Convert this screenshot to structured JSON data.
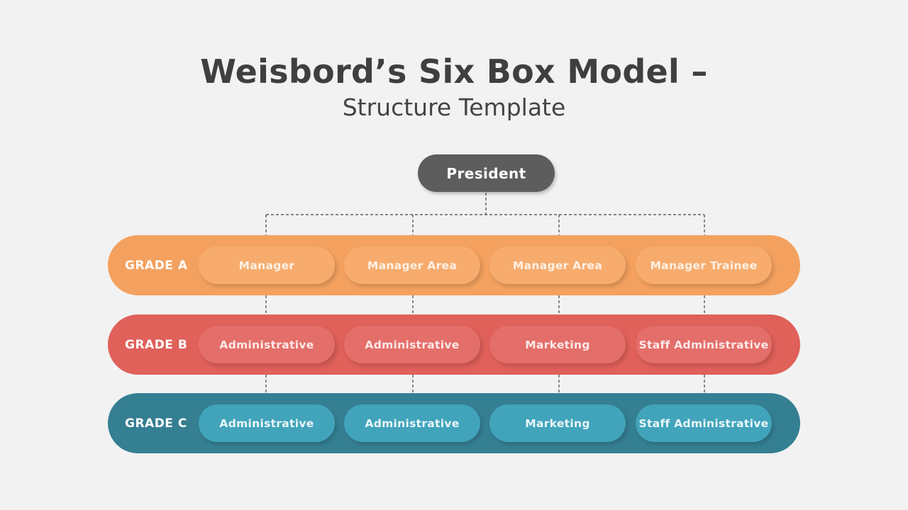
{
  "title": "Weisbord’s Six Box Model –",
  "subtitle": "Structure Template",
  "top_node": {
    "label": "President",
    "color": "#5d5d5d"
  },
  "grades": [
    {
      "label": "GRADE A",
      "color": "#f4a15f",
      "roles": [
        "Manager",
        "Manager Area",
        "Manager Area",
        "Manager Trainee"
      ]
    },
    {
      "label": "GRADE B",
      "color": "#e0605a",
      "roles": [
        "Administrative",
        "Administrative",
        "Marketing",
        "Staff Administrative"
      ]
    },
    {
      "label": "GRADE C",
      "color": "#357f93",
      "roles": [
        "Administrative",
        "Administrative",
        "Marketing",
        "Staff Administrative"
      ]
    }
  ]
}
